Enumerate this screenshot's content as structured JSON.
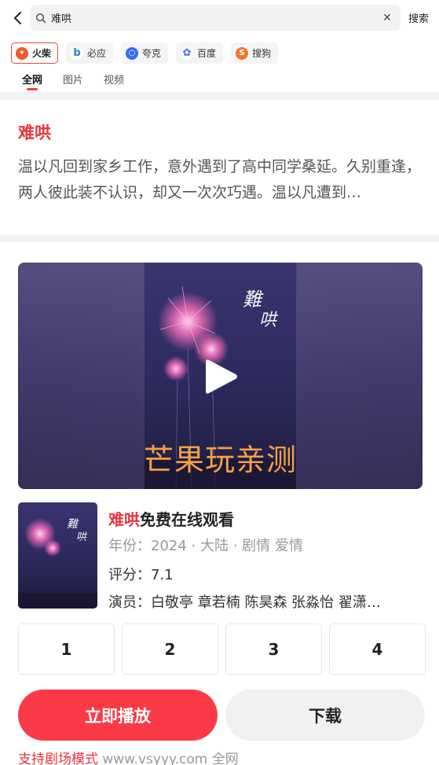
{
  "search": {
    "query": "难哄",
    "button": "搜索"
  },
  "engines": [
    {
      "label": "火柴",
      "color": "#f0572a"
    },
    {
      "label": "必应",
      "color": "#2b7cd3"
    },
    {
      "label": "夸克",
      "color": "#2f6df5"
    },
    {
      "label": "百度",
      "color": "#3a6fe0"
    },
    {
      "label": "搜狗",
      "color": "#f0772a"
    }
  ],
  "tabs": [
    "全网",
    "图片",
    "视频"
  ],
  "summary": {
    "title": "难哄",
    "text": "温以凡回到家乡工作，意外遇到了高中同学桑延。久别重逢，两人彼此装不认识，却又一次次巧遇。温以凡遭到…"
  },
  "video": {
    "watermark": "芒果玩亲测"
  },
  "result": {
    "title_highlight": "难哄",
    "title_rest": "免费在线观看",
    "meta": "年份：2024 · 大陆 · 剧情 爱情",
    "rating": "评分：7.1",
    "cast": "演员：白敬亭 章若楠 陈昊森 张淼怡 翟潇…"
  },
  "episodes": [
    "1",
    "2",
    "3",
    "4"
  ],
  "actions": {
    "play": "立即播放",
    "download": "下载"
  },
  "footer": {
    "mode": "支持剧场模式",
    "site": "www.vsyyy.com 全网"
  },
  "colors": {
    "accent": "#e8343c",
    "play_button": "#fb3a48"
  }
}
